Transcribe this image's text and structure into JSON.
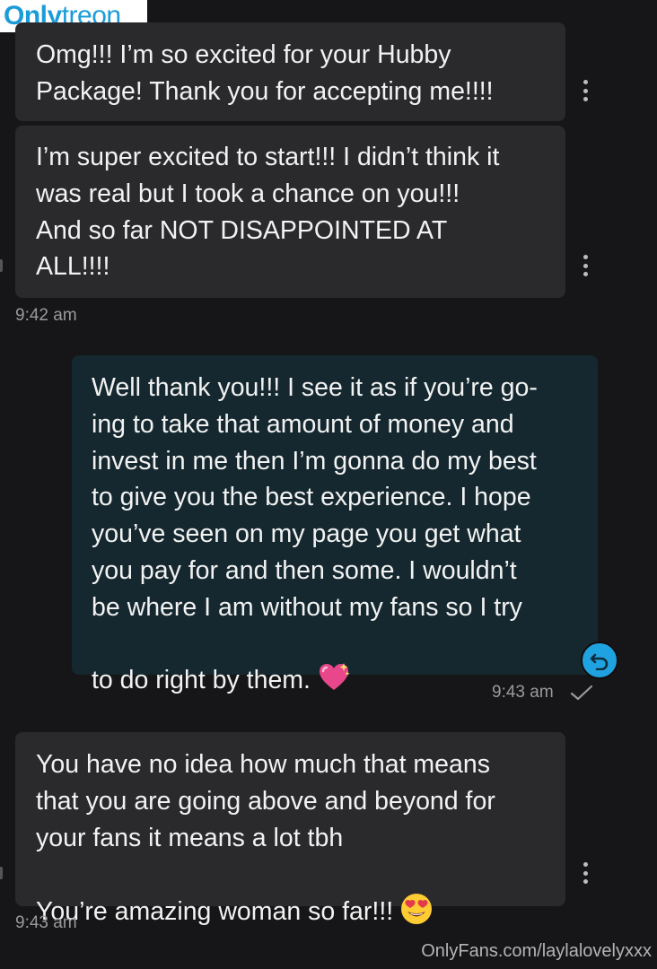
{
  "watermark_logo": {
    "part_a": "Only",
    "part_b": "treon"
  },
  "messages": [
    {
      "text": "Omg!!! I’m so excited for your Hubby\nPackage! Thank you for accepting me!!!!"
    },
    {
      "text": "I’m super excited to start!!! I didn’t think it\nwas real but I took a chance on you!!!\nAnd so far NOT DISAPPOINTED AT\nALL!!!!",
      "timestamp": "9:42 am"
    },
    {
      "text": "Well thank you!!! I see it as if you’re go-\ning to take that amount of money and\ninvest in me then I’m gonna do my best\nto give you the best experience. I hope\nyou’ve seen on my page you get what\nyou pay for and then some. I wouldn’t\nbe where I am without my fans so I try\nto do right by them. ",
      "emoji": "sparkling-heart",
      "timestamp": "9:43 am"
    },
    {
      "text": "You have no idea how much that means\nthat you are going above and beyond for\nyour fans it means a lot tbh\nYou’re amazing woman so far!!! ",
      "emoji": "heart-eyes",
      "timestamp": "9:43 am"
    }
  ],
  "footer_watermark": "OnlyFans.com/laylalovelyxxx",
  "colors": {
    "background": "#161618",
    "incoming_bubble": "#2a2a2d",
    "outgoing_bubble": "#15282f",
    "accent": "#1fa3e0"
  }
}
